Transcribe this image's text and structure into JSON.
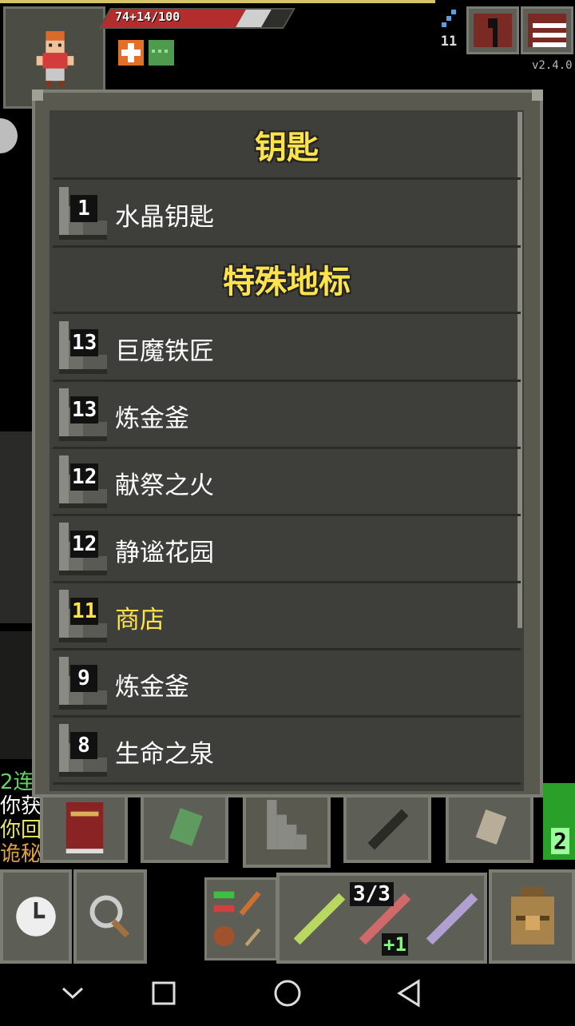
{
  "hud": {
    "hp_text": "74+14/100",
    "hp_fraction": 0.74,
    "shield_fraction": 0.14,
    "depth": "11",
    "version": "v2.4.0"
  },
  "journal": {
    "keys_title": "钥匙",
    "keys": [
      {
        "depth": "1",
        "name": "水晶钥匙",
        "current": false
      }
    ],
    "landmarks_title": "特殊地标",
    "landmarks": [
      {
        "depth": "13",
        "name": "巨魔铁匠",
        "current": false
      },
      {
        "depth": "13",
        "name": "炼金釜",
        "current": false
      },
      {
        "depth": "12",
        "name": "献祭之火",
        "current": false
      },
      {
        "depth": "12",
        "name": "静谧花园",
        "current": false
      },
      {
        "depth": "11",
        "name": "商店",
        "current": true
      },
      {
        "depth": "9",
        "name": "炼金釜",
        "current": false
      },
      {
        "depth": "8",
        "name": "生命之泉",
        "current": false
      }
    ]
  },
  "log": [
    "2连",
    "你获",
    "你回",
    "诡秘"
  ],
  "tabs": [
    "guide-book",
    "alchemy-notes",
    "stairs",
    "catalog-weapon",
    "bestiary"
  ],
  "toolbar": {
    "charges": "3/3",
    "upgrade": "+1",
    "side_badge": "2"
  },
  "colors": {
    "panel": "#3e3f3a",
    "frame": "#59594f",
    "title_yellow": "#ffe34a",
    "hp_red": "#b42d2d",
    "green_badge": "#2aa02a"
  },
  "icons": [
    "hero-icon",
    "stairs-icon",
    "journal-icon",
    "menu-icon",
    "clock-icon",
    "magnifier-icon",
    "backpack-icon",
    "wand-icon"
  ]
}
